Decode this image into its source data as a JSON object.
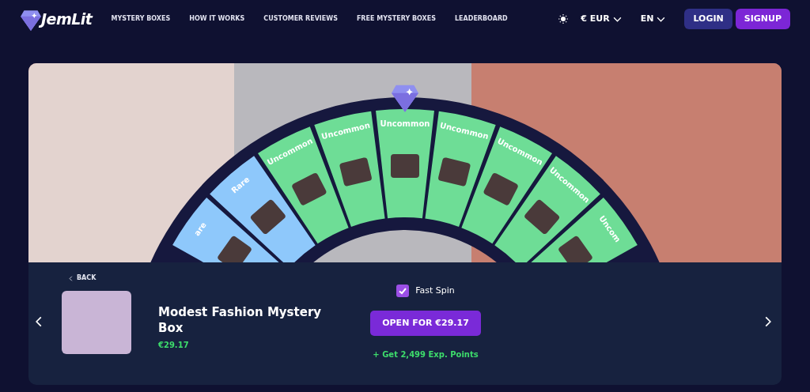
{
  "navbar": {
    "logo": "JemLit",
    "links": [
      "MYSTERY BOXES",
      "HOW IT WORKS",
      "CUSTOMER REVIEWS",
      "FREE MYSTERY BOXES",
      "LEADERBOARD"
    ],
    "currency": "EUR",
    "currency_symbol": "€",
    "language": "EN",
    "login": "LOGIN",
    "signup": "SIGNUP"
  },
  "wheel": {
    "segments": [
      {
        "label": "are",
        "color": "#8ec8fb"
      },
      {
        "label": "Rare",
        "color": "#8ec8fb"
      },
      {
        "label": "Uncommon",
        "color": "#6edd96"
      },
      {
        "label": "Uncommon",
        "color": "#6edd96"
      },
      {
        "label": "Uncommon",
        "color": "#6edd96"
      },
      {
        "label": "Uncommon",
        "color": "#6edd96"
      },
      {
        "label": "Uncommon",
        "color": "#6edd96"
      },
      {
        "label": "Uncommon",
        "color": "#6edd96"
      },
      {
        "label": "Uncom",
        "color": "#6edd96"
      }
    ]
  },
  "box": {
    "back": "BACK",
    "title": "Modest Fashion Mystery Box",
    "price": "€29.17",
    "fast_spin": {
      "label": "Fast Spin",
      "checked": true
    },
    "open_button": "OPEN FOR €29.17",
    "exp_text": "+ Get 2,499 Exp. Points"
  }
}
